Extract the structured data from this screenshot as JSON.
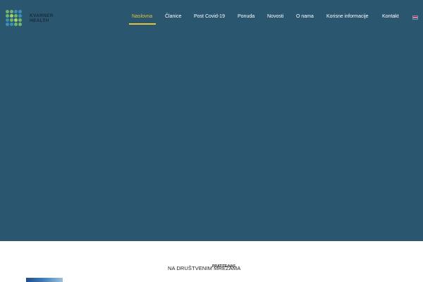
{
  "brand": {
    "line1": "KVARNER",
    "line2": "HEALTH"
  },
  "nav": {
    "items": [
      {
        "label": "Naslovna",
        "active": true
      },
      {
        "label": "Članice"
      },
      {
        "label": "Post Covid-19"
      },
      {
        "label": "Ponuda"
      },
      {
        "label": "Novosti"
      },
      {
        "label": "O nama"
      },
      {
        "label": "Korisne informacije"
      },
      {
        "label": "Kontakt"
      }
    ],
    "language_flag": "uk-flag-icon"
  },
  "footer_band": {
    "social_label": "NA DRUŠTVENIM MREŽAMA",
    "follow_label": "PRATITE NAS"
  },
  "colors": {
    "hero_bg": "#2a566f",
    "accent": "#e3c43a",
    "logo_green": "#6fb56b",
    "logo_blue": "#3c8fb4"
  }
}
